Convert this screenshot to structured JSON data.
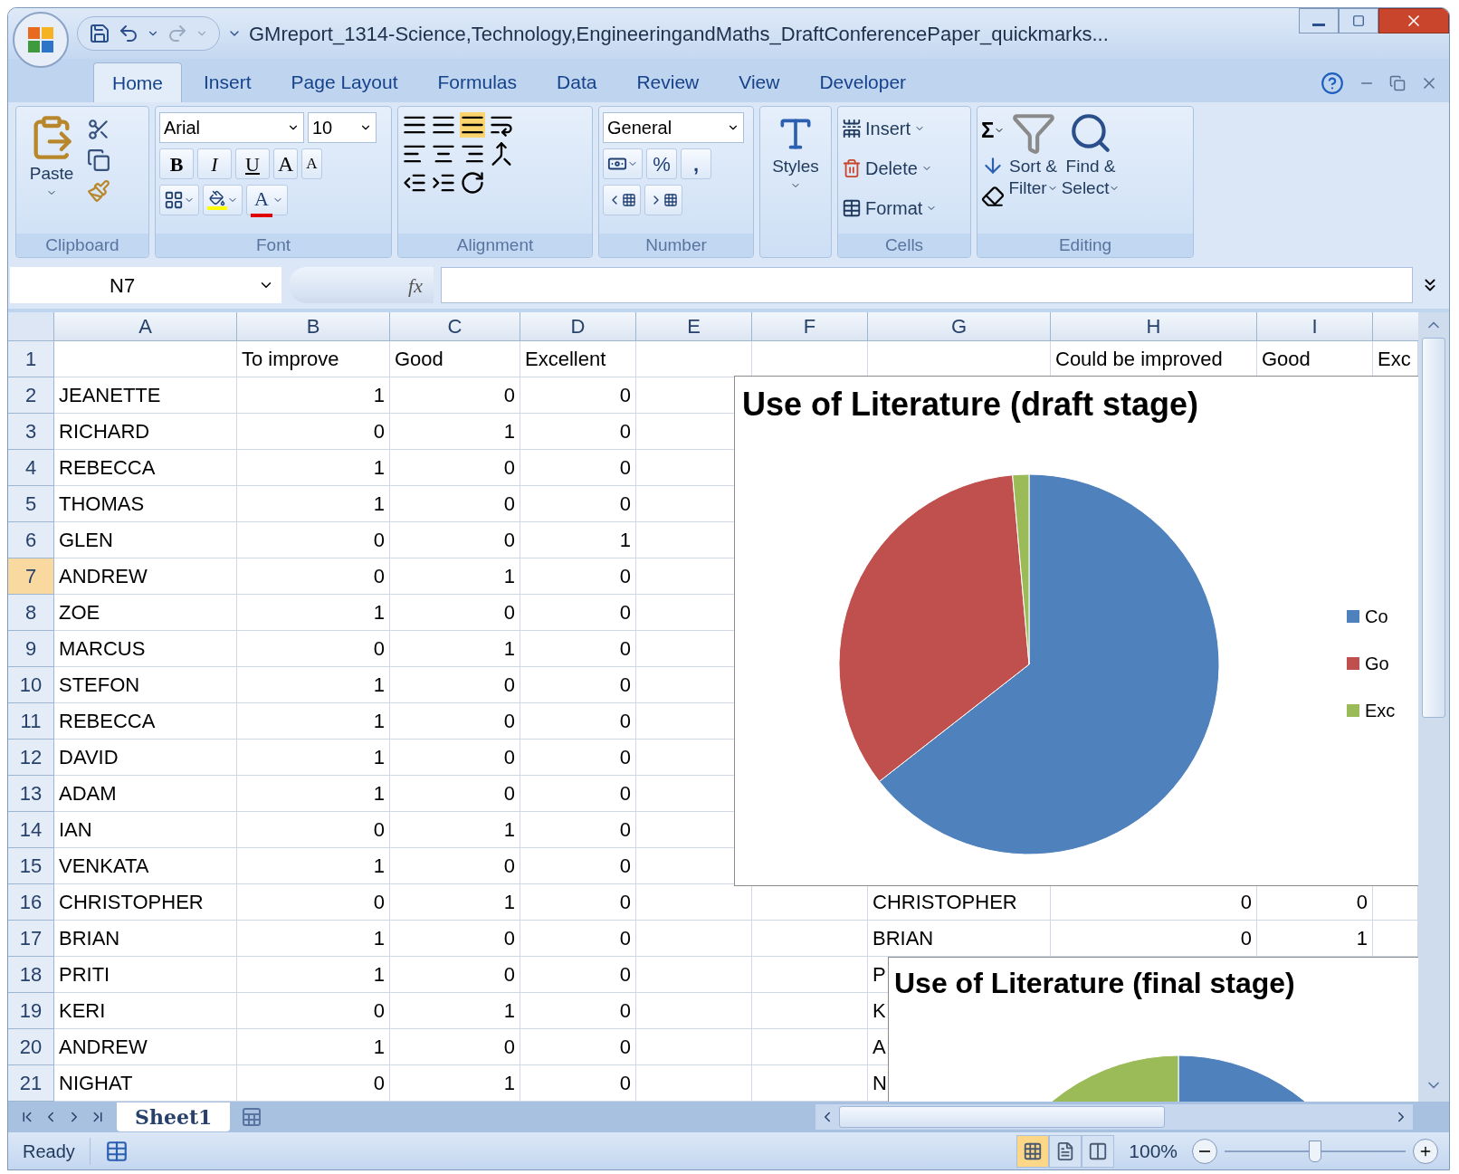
{
  "window": {
    "title": "GMreport_1314-Science,Technology,EngineeringandMaths_DraftConferencePaper_quickmarks..."
  },
  "ribbon_tabs": [
    {
      "label": "Home",
      "selected": true
    },
    {
      "label": "Insert",
      "selected": false
    },
    {
      "label": "Page Layout",
      "selected": false
    },
    {
      "label": "Formulas",
      "selected": false
    },
    {
      "label": "Data",
      "selected": false
    },
    {
      "label": "Review",
      "selected": false
    },
    {
      "label": "View",
      "selected": false
    },
    {
      "label": "Developer",
      "selected": false
    }
  ],
  "ribbon": {
    "clipboard": {
      "label": "Clipboard",
      "paste": "Paste"
    },
    "font": {
      "label": "Font",
      "font_name": "Arial",
      "font_size": "10",
      "style_buttons": [
        "B",
        "I",
        "U"
      ],
      "grow": "A",
      "shrink": "A",
      "font_color": "A"
    },
    "alignment": {
      "label": "Alignment"
    },
    "number": {
      "label": "Number",
      "format": "General",
      "percent": "%",
      "comma": ","
    },
    "styles": {
      "label": "Styles"
    },
    "cells": {
      "label": "Cells",
      "buttons": [
        "Insert",
        "Delete",
        "Format"
      ]
    },
    "editing": {
      "label": "Editing",
      "sum": "Σ",
      "sort": [
        "Sort &",
        "Filter"
      ],
      "find": [
        "Find &",
        "Select"
      ]
    }
  },
  "formula_bar": {
    "name_box": "N7",
    "function_label": "fx"
  },
  "columns": [
    "A",
    "B",
    "C",
    "D",
    "E",
    "F",
    "G",
    "H",
    "I"
  ],
  "rows": [
    {
      "number": "1",
      "selected": false,
      "b": "To improve",
      "c": "Good",
      "d": "Excellent",
      "h": "Could be improved",
      "i": "Good",
      "j": "Exc"
    },
    {
      "number": "2",
      "selected": false,
      "a": "JEANETTE",
      "b": "1",
      "c": "0",
      "d": "0"
    },
    {
      "number": "3",
      "selected": false,
      "a": "RICHARD",
      "b": "0",
      "c": "1",
      "d": "0"
    },
    {
      "number": "4",
      "selected": false,
      "a": "REBECCA",
      "b": "1",
      "c": "0",
      "d": "0"
    },
    {
      "number": "5",
      "selected": false,
      "a": "THOMAS",
      "b": "1",
      "c": "0",
      "d": "0"
    },
    {
      "number": "6",
      "selected": false,
      "a": "GLEN",
      "b": "0",
      "c": "0",
      "d": "1"
    },
    {
      "number": "7",
      "selected": true,
      "a": "ANDREW",
      "b": "0",
      "c": "1",
      "d": "0"
    },
    {
      "number": "8",
      "selected": false,
      "a": "ZOE",
      "b": "1",
      "c": "0",
      "d": "0"
    },
    {
      "number": "9",
      "selected": false,
      "a": "MARCUS",
      "b": "0",
      "c": "1",
      "d": "0"
    },
    {
      "number": "10",
      "selected": false,
      "a": "STEFON",
      "b": "1",
      "c": "0",
      "d": "0"
    },
    {
      "number": "11",
      "selected": false,
      "a": "REBECCA",
      "b": "1",
      "c": "0",
      "d": "0"
    },
    {
      "number": "12",
      "selected": false,
      "a": "DAVID",
      "b": "1",
      "c": "0",
      "d": "0"
    },
    {
      "number": "13",
      "selected": false,
      "a": "ADAM",
      "b": "1",
      "c": "0",
      "d": "0"
    },
    {
      "number": "14",
      "selected": false,
      "a": "IAN",
      "b": "0",
      "c": "1",
      "d": "0"
    },
    {
      "number": "15",
      "selected": false,
      "a": "VENKATA",
      "b": "1",
      "c": "0",
      "d": "0"
    },
    {
      "number": "16",
      "selected": false,
      "a": "CHRISTOPHER",
      "b": "0",
      "c": "1",
      "d": "0",
      "g": "CHRISTOPHER",
      "h": "0",
      "i": "0"
    },
    {
      "number": "17",
      "selected": false,
      "a": "BRIAN",
      "b": "1",
      "c": "0",
      "d": "0",
      "g": "BRIAN",
      "h": "0",
      "i": "1"
    },
    {
      "number": "18",
      "selected": false,
      "a": "PRITI",
      "b": "1",
      "c": "0",
      "d": "0",
      "g": "P"
    },
    {
      "number": "19",
      "selected": false,
      "a": "KERI",
      "b": "0",
      "c": "1",
      "d": "0",
      "g": "K"
    },
    {
      "number": "20",
      "selected": false,
      "a": "ANDREW",
      "b": "1",
      "c": "0",
      "d": "0",
      "g": "A"
    },
    {
      "number": "21",
      "selected": false,
      "a": "NIGHAT",
      "b": "0",
      "c": "1",
      "d": "0",
      "g": "N"
    }
  ],
  "charts": [
    {
      "title": "Use of Literature (draft stage)",
      "legend": [
        {
          "label": "Co",
          "color": "#4f81bd"
        },
        {
          "label": "Go",
          "color": "#c0504d"
        },
        {
          "label": "Exc",
          "color": "#9bbb59"
        }
      ]
    },
    {
      "title": "Use of Literature (final stage)"
    }
  ],
  "sheet_tabs": [
    {
      "label": "Sheet1",
      "selected": true
    }
  ],
  "status_bar": {
    "status": "Ready",
    "views": [
      {
        "kind": "normal",
        "selected": true
      },
      {
        "kind": "layout",
        "selected": false
      },
      {
        "kind": "break",
        "selected": false
      }
    ],
    "zoom": "100%",
    "zoom_level": {
      "level": 0.5
    }
  }
}
